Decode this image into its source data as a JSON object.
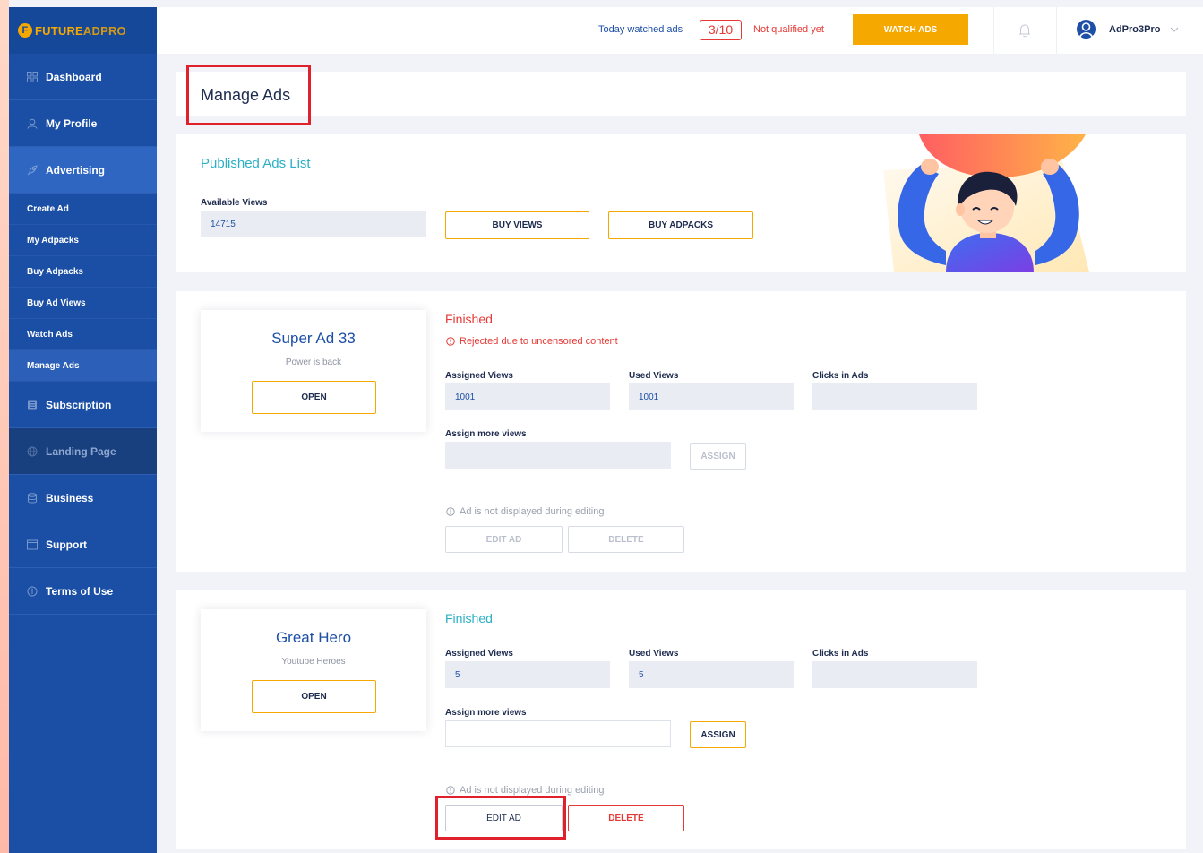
{
  "brand": {
    "prefix": "FUTURE",
    "accent": "ADPRO",
    "mark": "F"
  },
  "sidebar": {
    "items": [
      {
        "label": "Dashboard",
        "icon": "grid-icon"
      },
      {
        "label": "My Profile",
        "icon": "user-icon"
      },
      {
        "label": "Advertising",
        "icon": "rocket-icon"
      }
    ],
    "sub_items": [
      {
        "label": "Create Ad"
      },
      {
        "label": "My Adpacks"
      },
      {
        "label": "Buy Adpacks"
      },
      {
        "label": "Buy Ad Views"
      },
      {
        "label": "Watch Ads"
      },
      {
        "label": "Manage Ads"
      }
    ],
    "items_after": [
      {
        "label": "Subscription",
        "icon": "document-icon"
      },
      {
        "label": "Landing Page",
        "icon": "globe-icon"
      },
      {
        "label": "Business",
        "icon": "database-icon"
      },
      {
        "label": "Support",
        "icon": "window-icon"
      },
      {
        "label": "Terms of Use",
        "icon": "info-icon"
      }
    ]
  },
  "topbar": {
    "today_label": "Today watched ads",
    "counter": "3/10",
    "status": "Not qualified yet",
    "watch_button": "WATCH ADS",
    "username": "AdPro3Pro"
  },
  "page": {
    "title": "Manage Ads"
  },
  "published": {
    "title": "Published Ads List",
    "available_label": "Available Views",
    "available_value": "14715",
    "buy_views": "BUY VIEWS",
    "buy_adpacks": "BUY ADPACKS"
  },
  "ads": [
    {
      "name": "Super Ad 33",
      "subtitle": "Power is back",
      "open": "OPEN",
      "status": "Finished",
      "reason": "Rejected due to uncensored content",
      "assigned_label": "Assigned Views",
      "assigned_value": "1001",
      "used_label": "Used Views",
      "used_value": "1001",
      "clicks_label": "Clicks in Ads",
      "clicks_value": "",
      "assign_more_label": "Assign more views",
      "assign_button": "ASSIGN",
      "note": "Ad is not displayed during editing",
      "edit": "EDIT AD",
      "delete": "DELETE"
    },
    {
      "name": "Great Hero",
      "subtitle": "Youtube Heroes",
      "open": "OPEN",
      "status": "Finished",
      "assigned_label": "Assigned Views",
      "assigned_value": "5",
      "used_label": "Used Views",
      "used_value": "5",
      "clicks_label": "Clicks in Ads",
      "clicks_value": "",
      "assign_more_label": "Assign more views",
      "assign_button": "ASSIGN",
      "note": "Ad is not displayed during editing",
      "edit": "EDIT AD",
      "delete": "DELETE"
    }
  ],
  "colors": {
    "accent": "#f5a800",
    "sidebar": "#1a4fa5",
    "danger": "#e53935",
    "teal": "#2bb0c4"
  }
}
